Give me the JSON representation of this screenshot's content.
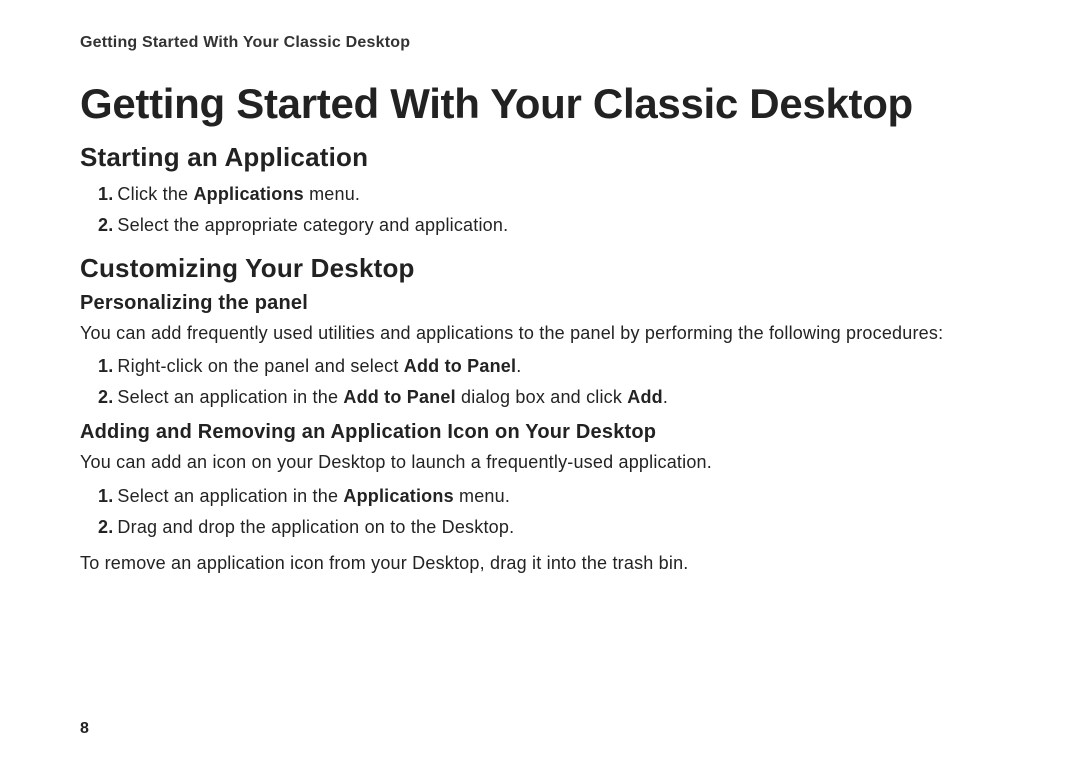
{
  "running_header": "Getting Started With Your Classic Desktop",
  "title": "Getting Started With Your Classic Desktop",
  "section1": {
    "heading": "Starting an Application",
    "steps": [
      {
        "num": "1.",
        "pre": "Click the ",
        "bold": "Applications",
        "post": " menu."
      },
      {
        "num": "2.",
        "text": "Select the appropriate category and application."
      }
    ]
  },
  "section2": {
    "heading": "Customizing Your Desktop",
    "sub1": {
      "heading": "Personalizing the panel",
      "intro": "You can add frequently used utilities and applications to the panel by performing the following procedures:",
      "steps": [
        {
          "num": "1.",
          "pre": "Right-click on the panel and select ",
          "bold": "Add to Panel",
          "post": "."
        },
        {
          "num": "2.",
          "pre": "Select an application in the ",
          "bold": "Add to Panel",
          "mid": " dialog box and click ",
          "bold2": "Add",
          "post": "."
        }
      ]
    },
    "sub2": {
      "heading": "Adding and Removing an Application Icon on Your Desktop",
      "intro": "You can add an icon on your Desktop to launch a frequently-used application.",
      "steps": [
        {
          "num": "1.",
          "pre": "Select an application in the ",
          "bold": "Applications",
          "post": " menu."
        },
        {
          "num": "2.",
          "text": "Drag and drop the application on to the Desktop."
        }
      ],
      "outro": "To remove an application icon from your Desktop, drag it into the trash bin."
    }
  },
  "page_number": "8"
}
